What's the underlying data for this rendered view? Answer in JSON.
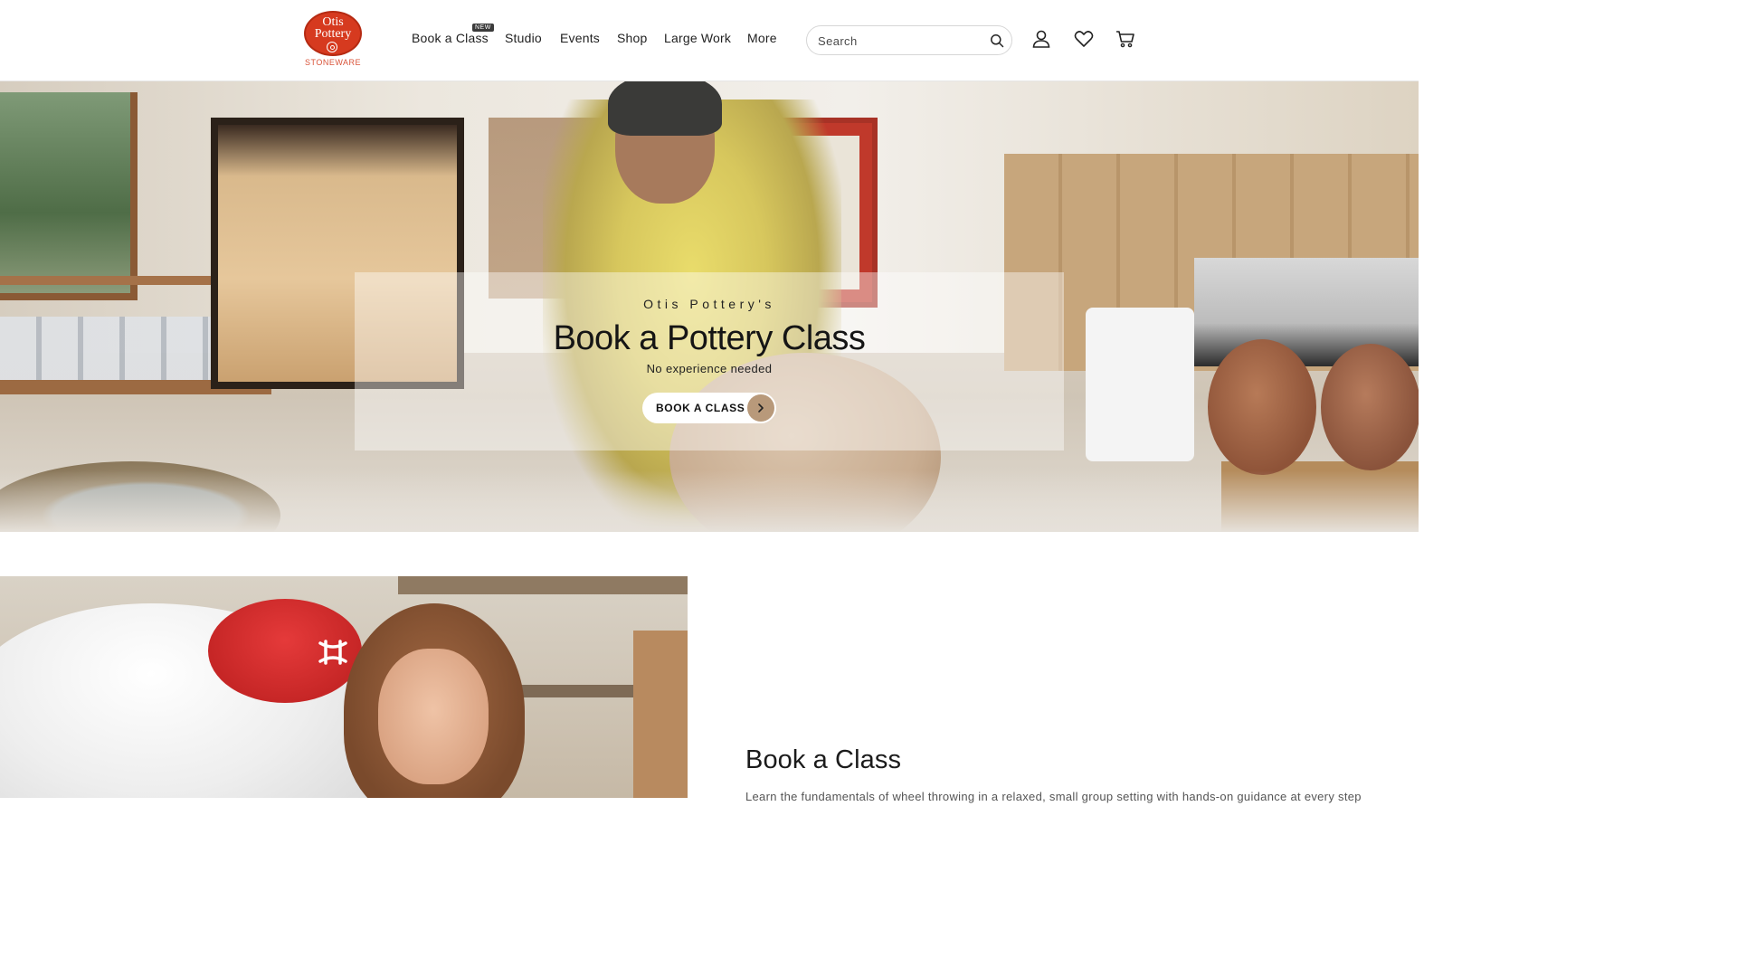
{
  "header": {
    "logo": {
      "line1": "Otis",
      "line2": "Pottery",
      "sub": "STONEWARE"
    },
    "nav": [
      {
        "label": "Book a Class"
      },
      {
        "label": "Studio"
      },
      {
        "label": "Events"
      },
      {
        "label": "Shop"
      },
      {
        "label": "Large Work"
      },
      {
        "label": "More"
      }
    ],
    "nav_badge": "NEW",
    "search": {
      "placeholder": "Search"
    },
    "icons": [
      "search-icon",
      "account-icon",
      "wishlist-heart-icon",
      "cart-icon"
    ]
  },
  "hero": {
    "kicker": "Otis Pottery's",
    "title": "Book a Pottery Class",
    "subtitle": "No experience needed",
    "button_label": "BOOK A CLASS",
    "button_icon": "chevron-right-icon"
  },
  "section": {
    "title": "Book a Class",
    "text": "Learn the fundamentals of wheel throwing in a relaxed, small group setting with hands-on guidance at every step"
  },
  "colors": {
    "brand_red": "#d63a1f",
    "button_accent": "#b8997a"
  }
}
